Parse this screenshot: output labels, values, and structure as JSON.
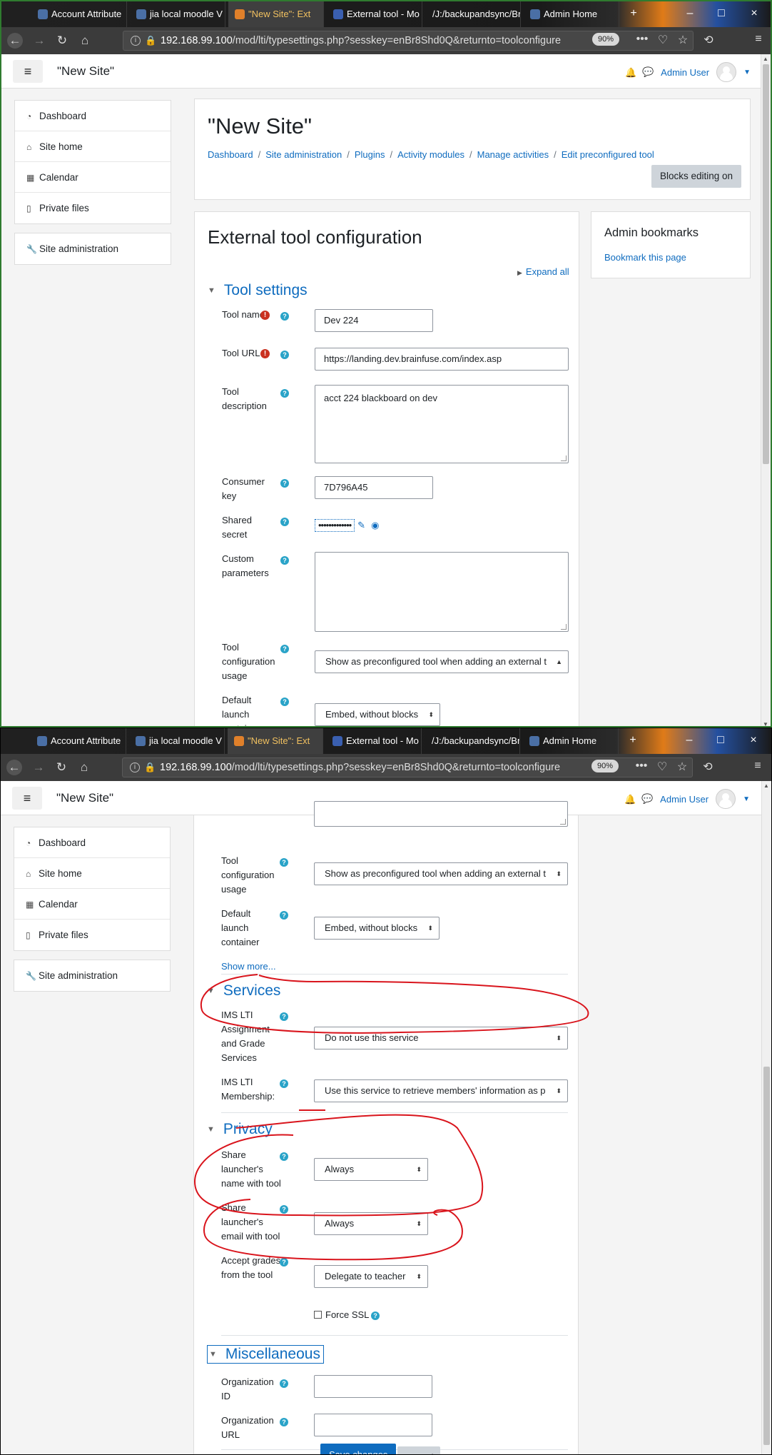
{
  "browser": {
    "tabs": [
      {
        "label": "Account Attribute"
      },
      {
        "label": "jia local moodle V"
      },
      {
        "label": "\"New Site\": Ext"
      },
      {
        "label": "External tool - Mo"
      },
      {
        "label": "/J:/backupandsync/Br"
      },
      {
        "label": "Admin Home"
      }
    ],
    "url_host": "192.168.99.100",
    "url_path": "/mod/lti/typesettings.php?sesskey=enBr8Shd0Q&returnto=toolconfigure",
    "zoom": "90%"
  },
  "header": {
    "site_name": "\"New Site\"",
    "user_name": "Admin User"
  },
  "sidebar": {
    "items": [
      {
        "label": "Dashboard",
        "icon": "dashboard-icon"
      },
      {
        "label": "Site home",
        "icon": "home-icon"
      },
      {
        "label": "Calendar",
        "icon": "calendar-icon"
      },
      {
        "label": "Private files",
        "icon": "file-icon"
      }
    ],
    "admin_label": "Site administration"
  },
  "page": {
    "heading": "\"New Site\"",
    "breadcrumb": [
      "Dashboard",
      "Site administration",
      "Plugins",
      "Activity modules",
      "Manage activities",
      "Edit preconfigured tool"
    ],
    "blocks_editing_button": "Blocks editing on",
    "form_heading": "External tool configuration",
    "expand_all": "Expand all"
  },
  "admin_bookmarks": {
    "title": "Admin bookmarks",
    "link": "Bookmark this page"
  },
  "form": {
    "tool_settings_heading": "Tool settings",
    "tool_name_label": "Tool name",
    "tool_name_value": "Dev 224",
    "tool_url_label": "Tool URL",
    "tool_url_value": "https://landing.dev.brainfuse.com/index.asp",
    "tool_description_label": "Tool description",
    "tool_description_value": "acct 224 blackboard on dev",
    "consumer_key_label": "Consumer key",
    "consumer_key_value": "7D796A45",
    "shared_secret_label": "Shared secret",
    "shared_secret_mask": "•••••••••••••",
    "custom_parameters_label": "Custom parameters",
    "tool_config_usage_label": "Tool configuration usage",
    "tool_config_usage_value": "Show as preconfigured tool when adding an external t",
    "default_launch_label": "Default launch container",
    "default_launch_value": "Embed, without blocks",
    "show_more": "Show more...",
    "services_heading": "Services",
    "ags_label": "IMS LTI Assignment and Grade Services",
    "ags_value": "Do not use this service",
    "membership_label": "IMS LTI Membership:",
    "membership_value": "Use this service to retrieve members' information as p",
    "privacy_heading": "Privacy",
    "share_name_label": "Share launcher's name with tool",
    "share_name_value": "Always",
    "share_email_label": "Share launcher's email with tool",
    "share_email_value": "Always",
    "accept_grades_label": "Accept grades from the tool",
    "accept_grades_value": "Delegate to teacher",
    "force_ssl_label": "Force SSL",
    "misc_heading": "Miscellaneous",
    "org_id_label": "Organization ID",
    "org_url_label": "Organization URL",
    "save_button": "Save changes",
    "cancel_button": "Cancel"
  },
  "colors": {
    "moodle_blue": "#0f6cbf",
    "help_blue": "#29a3c8",
    "required_red": "#ca3120",
    "annotation_red": "#d9141c"
  }
}
